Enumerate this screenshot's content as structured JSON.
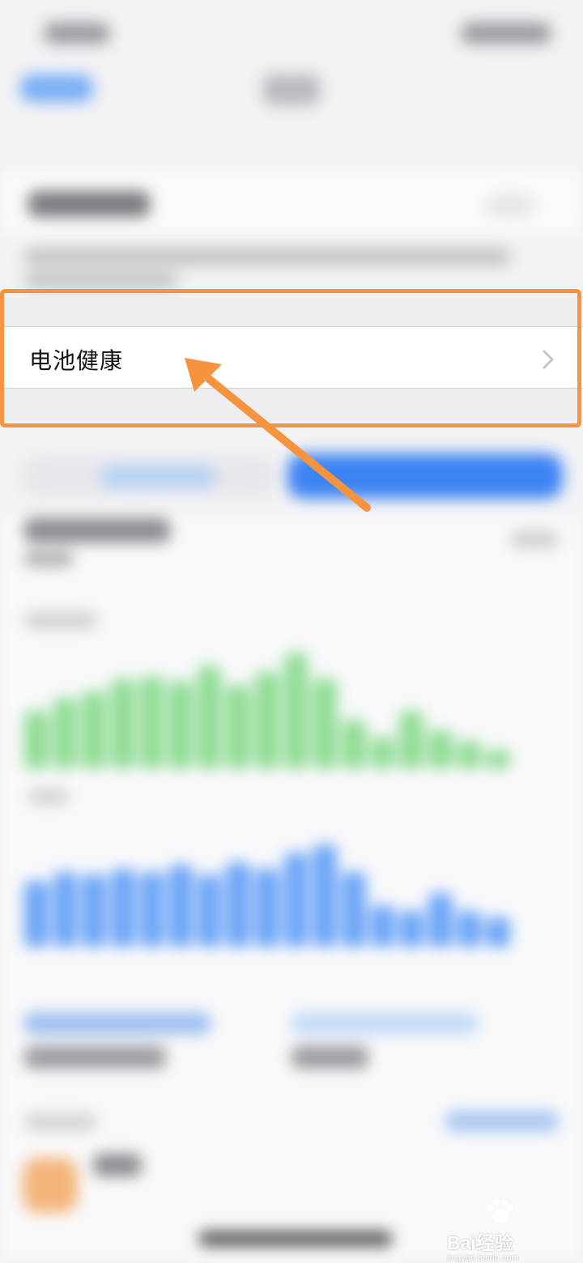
{
  "battery_health_row": {
    "label": "电池健康"
  },
  "colors": {
    "highlight": "#f5933f",
    "arrow": "#f5933f",
    "chart_green": "#8fdc94",
    "chart_blue": "#6aa4f7",
    "accent": "#3d84f3"
  },
  "icons": {
    "row_chevron": "chevron-right-icon",
    "annotation": "arrow-icon"
  },
  "watermark": {
    "logo": "Bai经验",
    "url": "jingyan.baidu.com"
  }
}
